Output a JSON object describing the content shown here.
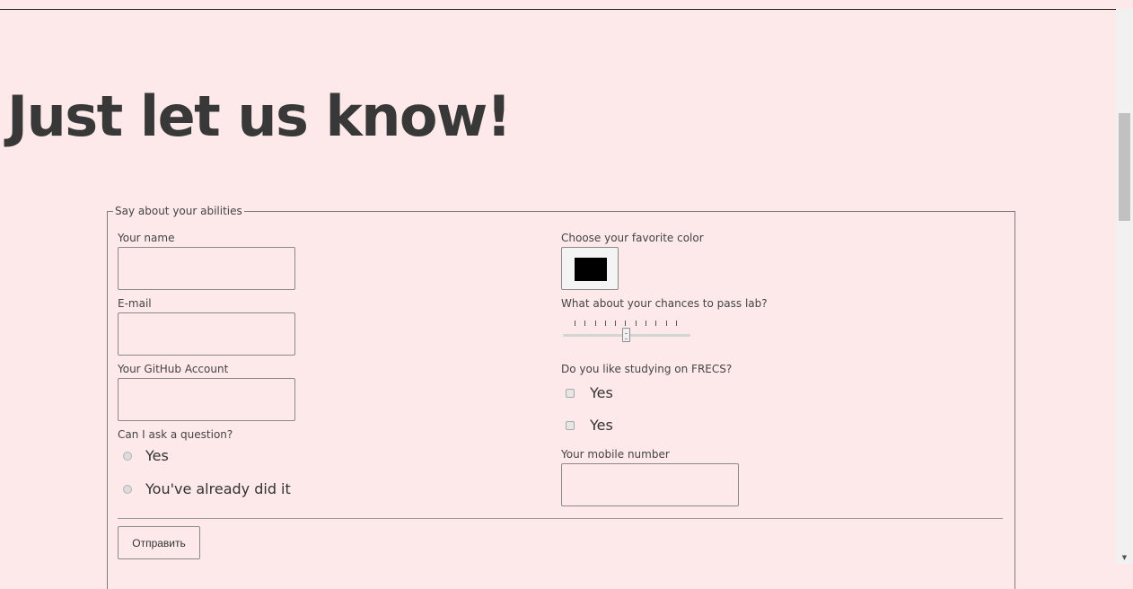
{
  "page": {
    "title": "Just let us know!"
  },
  "form": {
    "legend": "Say about your abilities",
    "name_label": "Your name",
    "email_label": "E-mail",
    "github_label": "Your GitHub Account",
    "question_label": "Can I ask a question?",
    "question_options": [
      "Yes",
      "You've already did it"
    ],
    "color_label": "Choose your favorite color",
    "color_value": "#000000",
    "chances_label": "What about your chances to pass lab?",
    "chances_value_percent": 50,
    "chances_tick_count": 11,
    "frecs_label": "Do you like studying on FRECS?",
    "frecs_options": [
      "Yes",
      "Yes"
    ],
    "mobile_label": "Your mobile number",
    "submit_label": "Отправить"
  },
  "colors": {
    "background": "#fde9ea",
    "text": "#383838",
    "border": "#8a8a8a"
  }
}
